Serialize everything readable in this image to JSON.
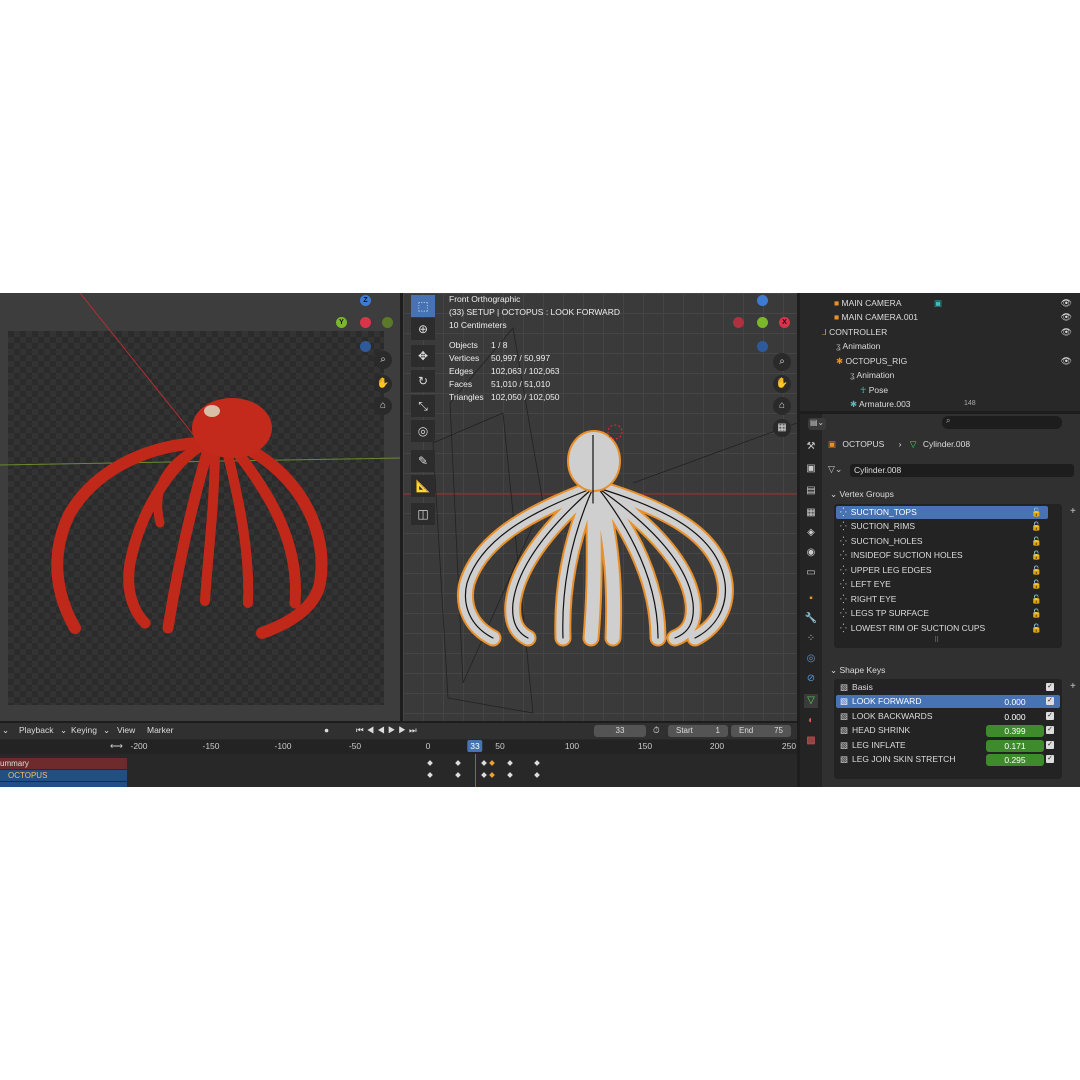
{
  "viewport_overlay": {
    "view_name": "Front Orthographic",
    "context": "(33) SETUP | OCTOPUS : LOOK FORWARD",
    "scale": "10 Centimeters",
    "stats": [
      {
        "label": "Objects",
        "value": "1 / 8"
      },
      {
        "label": "Vertices",
        "value": "50,997 / 50,997"
      },
      {
        "label": "Edges",
        "value": "102,063 / 102,063"
      },
      {
        "label": "Faces",
        "value": "51,010 / 51,010"
      },
      {
        "label": "Triangles",
        "value": "102,050 / 102,050"
      }
    ]
  },
  "gizmo": {
    "x": "X",
    "y": "Y",
    "z": "Z"
  },
  "timeline": {
    "menus": [
      "Playback",
      "Keying",
      "View",
      "Marker"
    ],
    "current_frame": "33",
    "start_label": "Start",
    "start_value": "1",
    "end_label": "End",
    "end_value": "75",
    "ruler_ticks": [
      "-200",
      "-150",
      "-100",
      "-50",
      "0",
      "50",
      "100",
      "150",
      "200",
      "250"
    ],
    "channels": [
      "ummary",
      "OCTOPUS"
    ]
  },
  "outliner": {
    "rows": [
      {
        "label": "MAIN CAMERA",
        "visible": true
      },
      {
        "label": "MAIN CAMERA.001",
        "visible": true
      },
      {
        "label": "CONTROLLER",
        "visible": true
      },
      {
        "label": "Animation",
        "visible": false
      },
      {
        "label": "OCTOPUS_RIG",
        "visible": true
      },
      {
        "label": "Animation",
        "visible": false
      },
      {
        "label": "Pose",
        "visible": false
      },
      {
        "label": "Armature.003",
        "visible": false,
        "badge": "148"
      }
    ]
  },
  "properties": {
    "breadcrumb": {
      "object": "OCTOPUS",
      "data": "Cylinder.008"
    },
    "mesh_name": "Cylinder.008",
    "vertex_groups": {
      "title": "Vertex Groups",
      "items": [
        "SUCTION_TOPS",
        "SUCTION_RIMS",
        "SUCTION_HOLES",
        "INSIDEOF SUCTION HOLES",
        "UPPER LEG EDGES",
        "LEFT EYE",
        "RIGHT EYE",
        "LEGS TP SURFACE",
        "LOWEST RIM OF SUCTION CUPS"
      ],
      "selected_index": 0
    },
    "shape_keys": {
      "title": "Shape Keys",
      "items": [
        {
          "name": "Basis",
          "value": ""
        },
        {
          "name": "LOOK FORWARD",
          "value": "0.000"
        },
        {
          "name": "LOOK BACKWARDS",
          "value": "0.000"
        },
        {
          "name": "HEAD SHRINK",
          "value": "0.399"
        },
        {
          "name": "LEG INFLATE",
          "value": "0.171"
        },
        {
          "name": "LEG JOIN SKIN STRETCH",
          "value": "0.295"
        }
      ],
      "selected_index": 1
    }
  },
  "colors": {
    "accent": "#4772b3",
    "keyframe_selected": "#f0a030",
    "value_green": "#3d8b2b",
    "selection_outline": "#e8902b"
  }
}
